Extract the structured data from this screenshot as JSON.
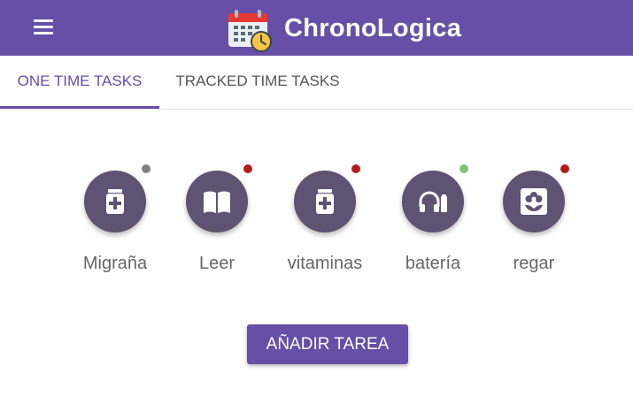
{
  "header": {
    "title": "ChronoLogica",
    "menu_icon": "menu-icon",
    "logo_icon": "calendar-clock-icon",
    "background": "#674ea7"
  },
  "tabs": [
    {
      "label": "ONE TIME TASKS",
      "active": true
    },
    {
      "label": "TRACKED TIME TASKS",
      "active": false
    }
  ],
  "tasks": [
    {
      "label": "Migraña",
      "icon": "medicine-jar-icon",
      "status_color": "#808080"
    },
    {
      "label": "Leer",
      "icon": "book-open-icon",
      "status_color": "#b71c1c"
    },
    {
      "label": "vitaminas",
      "icon": "medicine-jar-icon",
      "status_color": "#b71c1c"
    },
    {
      "label": "batería",
      "icon": "headphones-battery-icon",
      "status_color": "#7cc576"
    },
    {
      "label": "regar",
      "icon": "flower-icon",
      "status_color": "#b71c1c"
    }
  ],
  "add_button": {
    "label": "AÑADIR TAREA"
  },
  "colors": {
    "accent": "#674ea7",
    "task_circle": "#5f5273"
  }
}
